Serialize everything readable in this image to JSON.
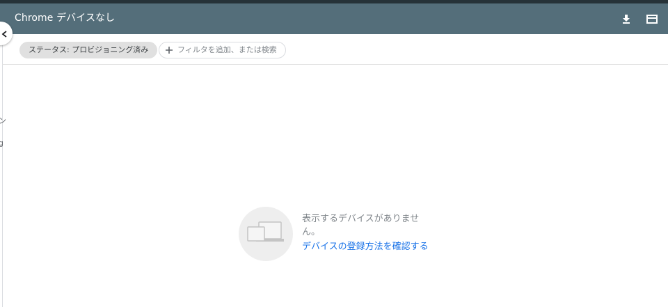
{
  "header": {
    "title": "Chrome デバイスなし",
    "download_icon": "download-icon",
    "card_icon": "credit-card-icon",
    "background_color": "#546e7a",
    "top_strip_color": "#263238"
  },
  "sidebar": {
    "collapse_icon": "chevron-left-icon",
    "fragments": [
      "ン",
      "g"
    ]
  },
  "filters": {
    "active_chip": "ステータス: プロビジョニング済み",
    "add_icon": "plus-icon",
    "add_placeholder": "フィルタを追加、または検索"
  },
  "empty_state": {
    "icon": "devices-icon",
    "message": "表示するデバイスがありません。",
    "link": "デバイスの登録方法を確認する",
    "link_color": "#1a73e8"
  }
}
